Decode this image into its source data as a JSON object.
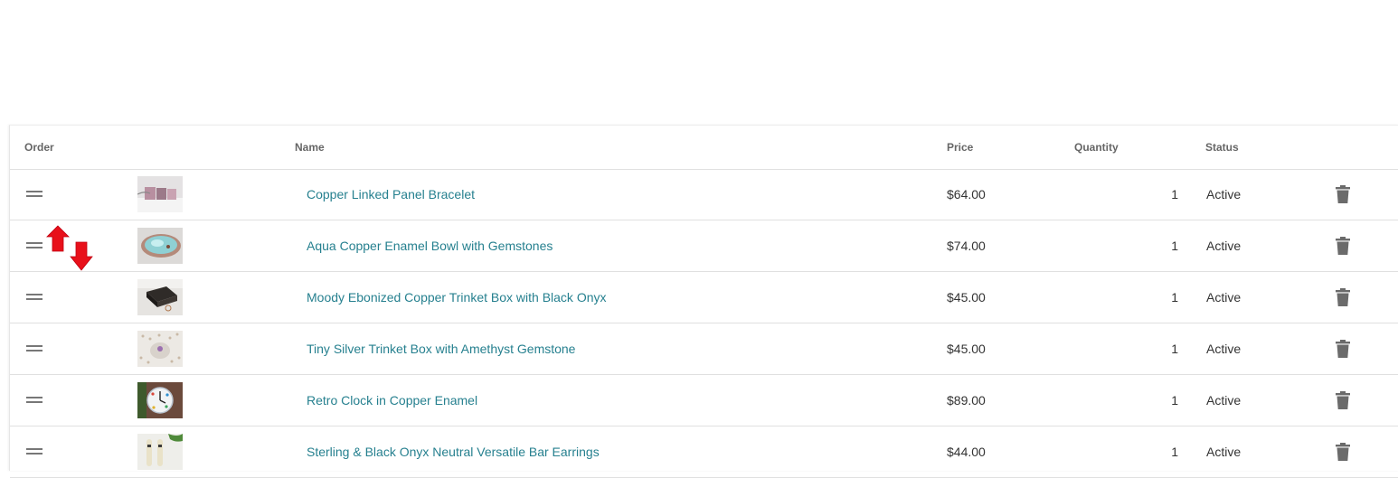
{
  "table": {
    "headers": {
      "order": "Order",
      "name": "Name",
      "price": "Price",
      "quantity": "Quantity",
      "status": "Status"
    },
    "rows": [
      {
        "name": "Copper Linked Panel Bracelet",
        "price": "$64.00",
        "quantity": "1",
        "status": "Active"
      },
      {
        "name": "Aqua Copper Enamel Bowl with Gemstones",
        "price": "$74.00",
        "quantity": "1",
        "status": "Active"
      },
      {
        "name": "Moody Ebonized Copper Trinket Box with Black Onyx",
        "price": "$45.00",
        "quantity": "1",
        "status": "Active"
      },
      {
        "name": "Tiny Silver Trinket Box with Amethyst Gemstone",
        "price": "$45.00",
        "quantity": "1",
        "status": "Active"
      },
      {
        "name": "Retro Clock in Copper Enamel",
        "price": "$89.00",
        "quantity": "1",
        "status": "Active"
      },
      {
        "name": "Sterling & Black Onyx Neutral Versatile Bar Earrings",
        "price": "$44.00",
        "quantity": "1",
        "status": "Active"
      }
    ]
  },
  "icons": {
    "drag": "drag-handle-icon",
    "delete": "trash-icon",
    "reorder": "reorder-arrows-icon"
  },
  "colors": {
    "link": "#26808f",
    "arrow": "#e8101a",
    "icon": "#6b6b6b"
  }
}
